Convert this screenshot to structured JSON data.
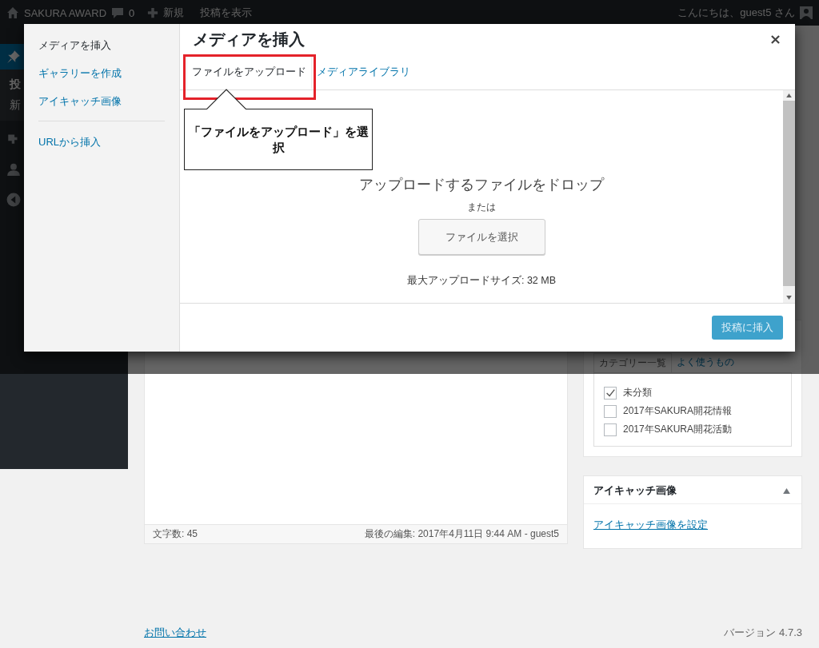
{
  "admin_bar": {
    "site_name": "SAKURA AWARD",
    "comments": "0",
    "new": "新規",
    "view_post": "投稿を表示",
    "greeting": "こんにちは、guest5 さん"
  },
  "admin_menu": {
    "section": "投",
    "submenu_item": "新"
  },
  "modal": {
    "title": "メディアを挿入",
    "menu_groups": [
      [
        {
          "label": "メディアを挿入",
          "selected": true
        },
        {
          "label": "ギャラリーを作成",
          "selected": false
        },
        {
          "label": "アイキャッチ画像",
          "selected": false
        }
      ],
      [
        {
          "label": "URLから挿入",
          "selected": false
        }
      ]
    ],
    "tabs": [
      {
        "label": "ファイルをアップロード",
        "selected": true
      },
      {
        "label": "メディアライブラリ",
        "selected": false
      }
    ],
    "upload": {
      "instructions": "アップロードするファイルをドロップ",
      "or": "または",
      "button": "ファイルを選択",
      "max_size": "最大アップロードサイズ: 32 MB"
    },
    "insert_button": {
      "label": "投稿に挿入",
      "disabled": true
    }
  },
  "annotation": {
    "text": "「ファイルをアップロード」を選択"
  },
  "editor": {
    "word_count": "文字数: 45",
    "last_edited": "最後の編集: 2017年4月11日 9:44 AM - guest5"
  },
  "categories": {
    "tabs": [
      {
        "label": "カテゴリー一覧",
        "selected": true
      },
      {
        "label": "よく使うもの",
        "selected": false
      }
    ],
    "items": [
      {
        "label": "未分類",
        "checked": true
      },
      {
        "label": "2017年SAKURA開花情報",
        "checked": false
      },
      {
        "label": "2017年SAKURA開花活動",
        "checked": false
      }
    ]
  },
  "featured_image": {
    "title": "アイキャッチ画像",
    "link": "アイキャッチ画像を設定"
  },
  "footer": {
    "contact": "お問い合わせ",
    "version": "バージョン 4.7.3"
  }
}
